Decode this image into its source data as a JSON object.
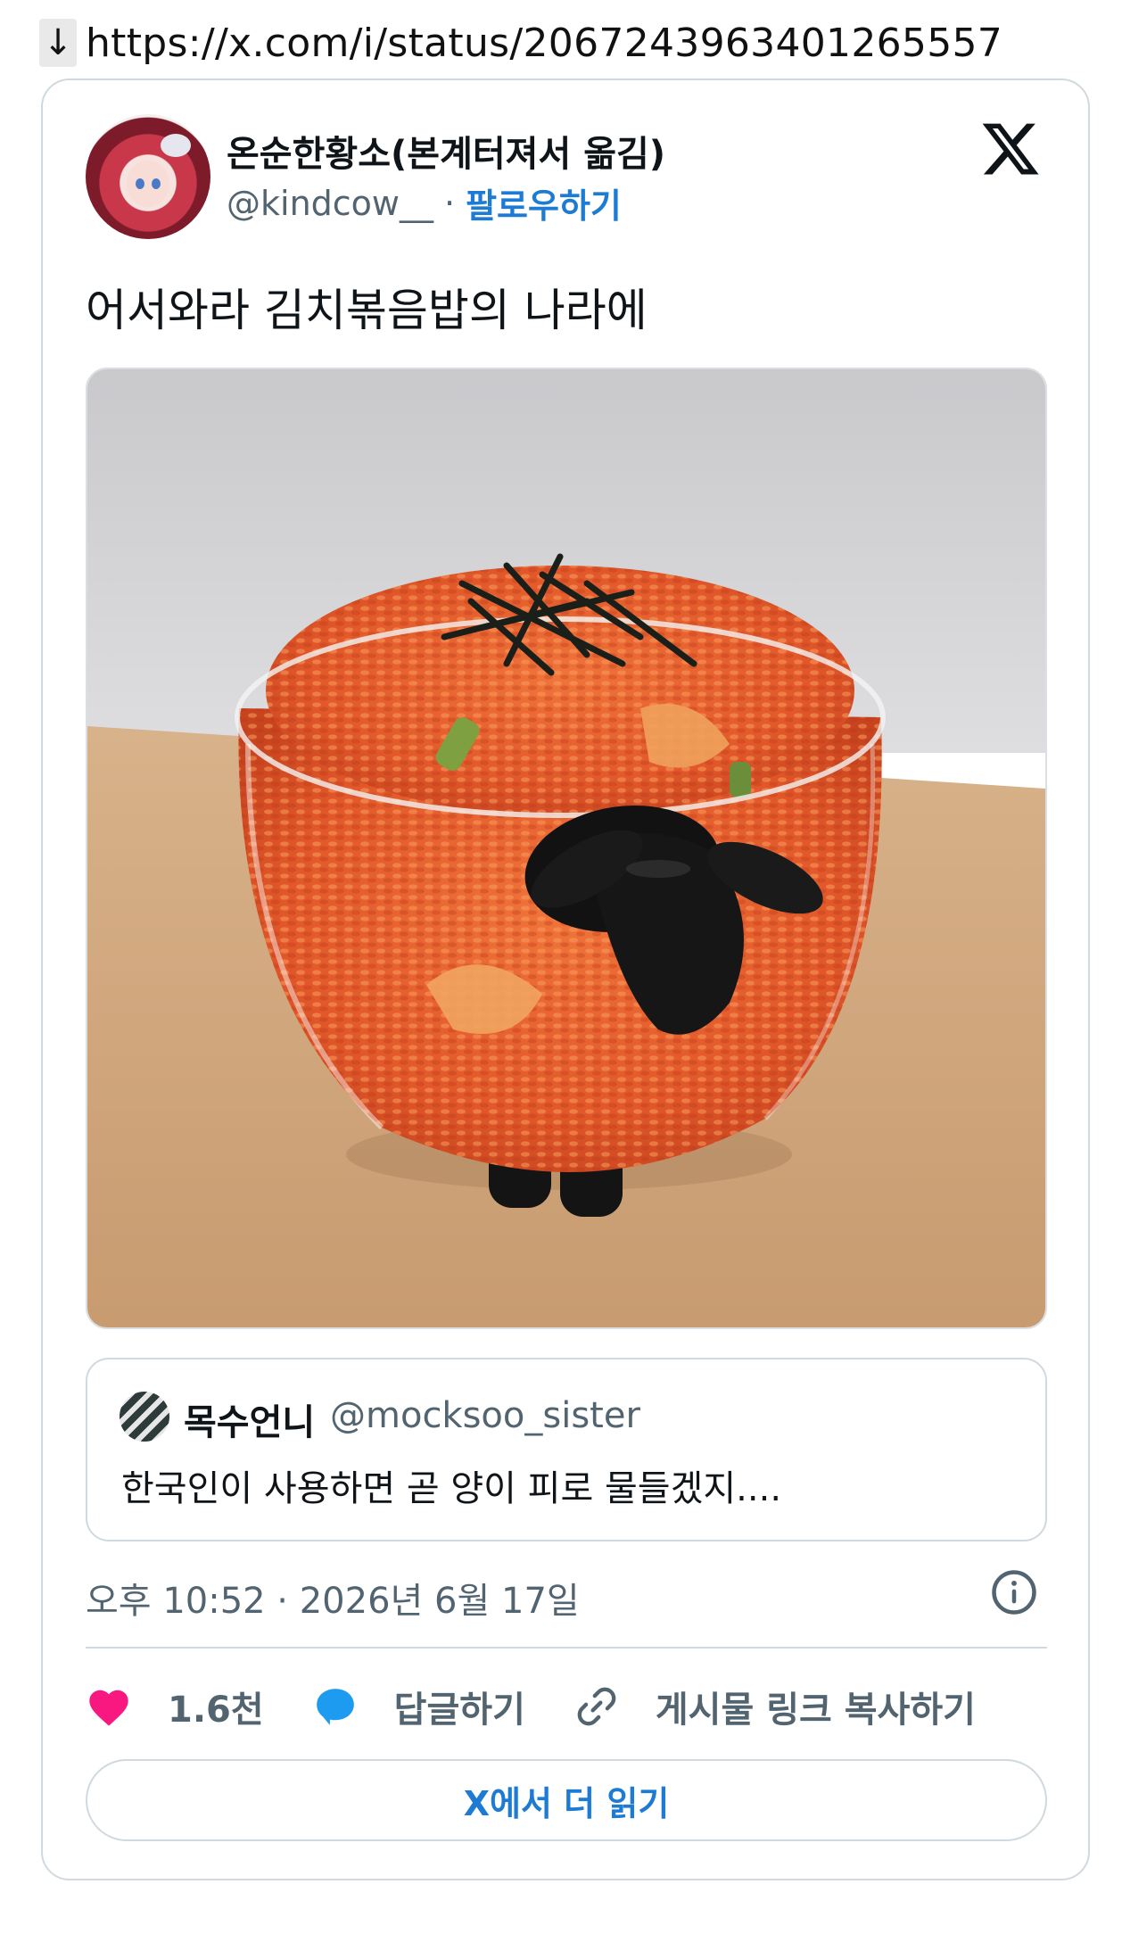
{
  "address_bar": {
    "download_arrow": "↓",
    "url": "https://x.com/i/status/2067243963401265557"
  },
  "tweet": {
    "author_name": "온순한황소(본계터져서 옮김)",
    "author_handle": "@kindcow__",
    "separator": "·",
    "follow_label": "팔로우하기",
    "text": "어서와라 김치볶음밥의 나라에",
    "timestamp": "오후 10:52 · 2026년 6월 17일"
  },
  "quoted_tweet": {
    "author_name": "목수언니",
    "author_handle": "@mocksoo_sister",
    "text": "한국인이 사용하면 곧 양이 피로 물들겠지...."
  },
  "actions": {
    "like_count": "1.6천",
    "reply_label": "답글하기",
    "copy_link_label": "게시물 링크 복사하기"
  },
  "read_more_label": "X에서 더 읽기",
  "colors": {
    "accent_blue": "#1d7bd4",
    "like_pink": "#f91880",
    "reply_blue": "#1d9bf0",
    "secondary_text": "#536471",
    "border": "#cfd9de"
  },
  "icons": [
    "download-arrow-icon",
    "x-logo-icon",
    "info-icon",
    "heart-icon",
    "reply-bubble-icon",
    "link-icon"
  ]
}
